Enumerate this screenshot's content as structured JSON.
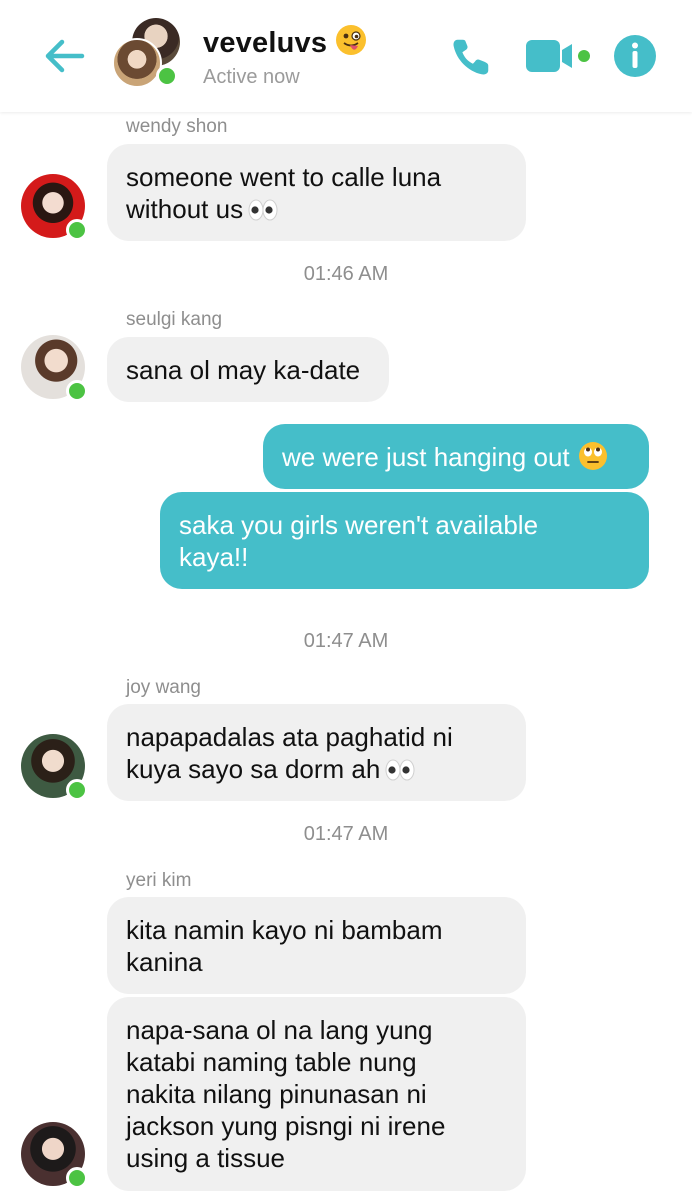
{
  "header": {
    "title": "veveluvs",
    "title_emoji": "winking-face-with-tongue",
    "status": "Active now"
  },
  "colors": {
    "accent": "#45bec9",
    "online": "#4cc343",
    "incoming_bubble": "#f0f0f0"
  },
  "icons": {
    "back": "back-arrow-icon",
    "call": "phone-icon",
    "video": "video-camera-icon",
    "info": "info-icon"
  },
  "messages": [
    {
      "sender": "wendy shon",
      "text": "someone went to calle luna\nwithout us",
      "emoji": "eyes"
    },
    {
      "time": "01:46 AM"
    },
    {
      "sender": "seulgi kang",
      "text": "sana ol may ka-date"
    },
    {
      "outgoing": true,
      "text": "we were just hanging out",
      "emoji": "face-with-rolling-eyes"
    },
    {
      "outgoing": true,
      "text": "saka you girls weren't available\nkaya!!"
    },
    {
      "time": "01:47 AM"
    },
    {
      "sender": "joy wang",
      "text": "napapadalas ata paghatid ni\nkuya sayo sa dorm ah",
      "emoji": "eyes"
    },
    {
      "time": "01:47 AM"
    },
    {
      "sender": "yeri kim",
      "text": "kita namin kayo ni bambam\nkanina"
    },
    {
      "text": "napa-sana ol na lang yung\nkatabi naming table nung\nnakita nilang pinunasan ni\njackson yung pisngi ni irene\nusing a tissue"
    }
  ]
}
